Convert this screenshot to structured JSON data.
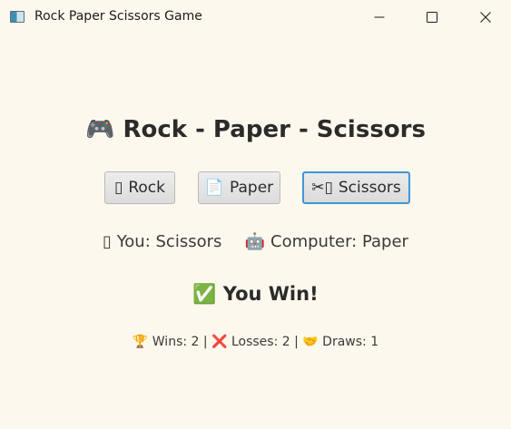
{
  "window": {
    "title": "Rock Paper Scissors Game",
    "app_icon": "window-app-icon",
    "controls": {
      "minimize_icon": "minimize-icon",
      "maximize_icon": "maximize-icon",
      "close_icon": "close-icon"
    }
  },
  "heading": {
    "icon": "🎮",
    "text": "Rock - Paper - Scissors"
  },
  "buttons": {
    "rock": {
      "icon": "▯",
      "label": "Rock"
    },
    "paper": {
      "icon": "📄",
      "label": "Paper"
    },
    "scissors": {
      "icon": "✂▯",
      "label": "Scissors",
      "focused": true
    }
  },
  "choices": {
    "you_icon": "▯",
    "you_text": "You: Scissors",
    "computer_icon": "🤖",
    "computer_text": "Computer: Paper"
  },
  "result": {
    "icon": "✅",
    "text": "You Win!"
  },
  "score": {
    "wins_icon": "🏆",
    "wins_text": "Wins: 2",
    "separator": "|",
    "losses_icon": "❌",
    "losses_text": "Losses: 2",
    "draws_icon": "🤝",
    "draws_text": "Draws: 1"
  },
  "colors": {
    "background": "#fdf8ed",
    "focus_border": "#3f97d9",
    "text": "#2b2b2b"
  }
}
